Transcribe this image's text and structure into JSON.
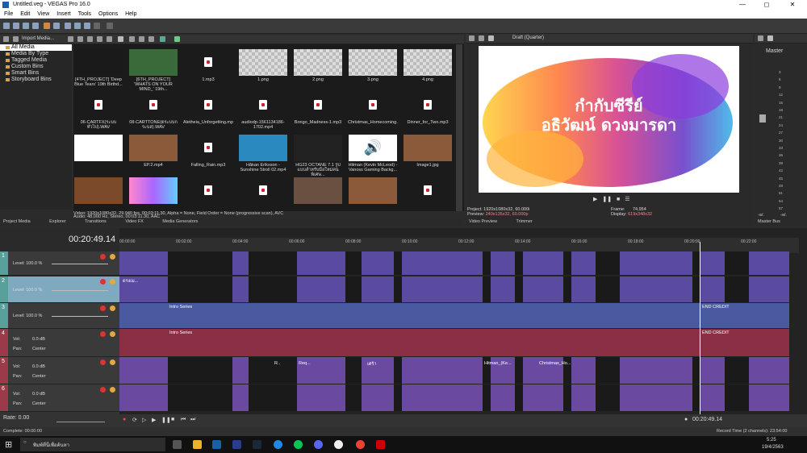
{
  "window": {
    "title": "Untitled.veg - VEGAS Pro 16.0"
  },
  "menu": [
    "File",
    "Edit",
    "View",
    "Insert",
    "Tools",
    "Options",
    "Help"
  ],
  "media_panel": {
    "import_label": "Import Media...",
    "tree": [
      {
        "label": "All Media",
        "selected": true
      },
      {
        "label": "Media By Type"
      },
      {
        "label": "Tagged Media"
      },
      {
        "label": "Custom Bins"
      },
      {
        "label": "Smart Bins"
      },
      {
        "label": "Storyboard Bins"
      }
    ],
    "items": [
      {
        "label": "[4TH_PROJECT] 'Deep Blue Tears' 19th Birthd...",
        "kind": "dark"
      },
      {
        "label": "[6TH_PROJECT] 'WHATS ON YOUR MIND_' 19th...",
        "kind": "green"
      },
      {
        "label": "1.mp3",
        "kind": "audio"
      },
      {
        "label": "1.png",
        "kind": "check"
      },
      {
        "label": "2.png",
        "kind": "check"
      },
      {
        "label": "3.png",
        "kind": "check"
      },
      {
        "label": "4.png",
        "kind": "check"
      },
      {
        "label": "06-CARTFX(ระบบทั่วไป).WAV",
        "kind": "audio"
      },
      {
        "label": "08-CARTTONE(ตระบบกระบส).WAV",
        "kind": "audio"
      },
      {
        "label": "Aletheia_Unforgetting.mp3",
        "kind": "audio"
      },
      {
        "label": "audiodp-1561134186-1702.mp4",
        "kind": "audio"
      },
      {
        "label": "Bongo_Madness-1.mp3",
        "kind": "audio"
      },
      {
        "label": "Christmas_Homecoming.mp3",
        "kind": "audio"
      },
      {
        "label": "Dinner_for_Two.mp3",
        "kind": "audio"
      },
      {
        "label": "",
        "kind": "title"
      },
      {
        "label": "EP.2.mp4",
        "kind": "room"
      },
      {
        "label": "Falling_Rain.mp3",
        "kind": "audio"
      },
      {
        "label": "Håkan Eriksson - Sunshine Stroll 02.mp4",
        "kind": "colorful"
      },
      {
        "label": "HG23 OCTANE 7.1 รูปแบบสำหรับมือใหม่คนพิเศษ...",
        "kind": "car"
      },
      {
        "label": "Hitman (Kevin McLeod) - Vanoss Gaming Backg...",
        "kind": "speaker"
      },
      {
        "label": "Image1.jpg",
        "kind": "room"
      },
      {
        "label": "",
        "kind": "room2"
      },
      {
        "label": "",
        "kind": "paint"
      },
      {
        "label": "",
        "kind": "audio"
      },
      {
        "label": "",
        "kind": "audio"
      },
      {
        "label": "",
        "kind": "room3"
      },
      {
        "label": "",
        "kind": "room"
      },
      {
        "label": "",
        "kind": "audio"
      }
    ],
    "status_line1": "Video: 1920x1080x32, 29.940 fps, 00:03:11.30, Alpha = None, Field Order = None (progressive scan), AVC",
    "status_line2": "Audio: 48,000 Hz, Stereo, 00:03:11.30, AAC",
    "tabs": [
      "Project Media",
      "Explorer",
      "Transitions",
      "Video FX",
      "Media Generators"
    ]
  },
  "preview": {
    "mode": "Draft (Quarter)",
    "title_line1": "กำกับซีรีย์",
    "title_line2": "อธิวัฒน์ ดวงมารดา",
    "project": "Project:  1920x1080x32, 60.000i",
    "preview_line": "Preview:",
    "preview_val": "240x135x32, 60.000p",
    "frame_label": "Frame:",
    "frame": "74,954",
    "display_label": "Display:",
    "display": "619x348x32",
    "tabs": [
      "Video Preview",
      "Trimmer"
    ]
  },
  "master": {
    "label": "Master",
    "tab": "Master Bus",
    "scale": [
      "3",
      "6",
      "9",
      "12",
      "15",
      "18",
      "21",
      "24",
      "27",
      "30",
      "33",
      "36",
      "39",
      "42",
      "45",
      "48",
      "51",
      "54",
      "57"
    ],
    "left": "-Inf.",
    "right": "-Inf."
  },
  "timeline": {
    "timecode": "00:20:49.14",
    "ruler": [
      "00:00:00",
      "00:02:00",
      "00:04:00",
      "00:06:00",
      "00:08:00",
      "00:10:00",
      "00:12:00",
      "00:14:00",
      "00:16:00",
      "00:18:00",
      "00:20:00",
      "00:22:00"
    ],
    "tracks": [
      {
        "num": "1",
        "level": "Level: 100.0 %",
        "type": "video"
      },
      {
        "num": "2",
        "level": "Level: 100.0 %",
        "type": "video",
        "selected": true
      },
      {
        "num": "3",
        "level": "Level: 100.0 %",
        "type": "video"
      },
      {
        "num": "4",
        "vol": "Vol:",
        "vol_val": "0.0 dB",
        "pan": "Pan:",
        "pan_val": "Center",
        "type": "audio"
      },
      {
        "num": "5",
        "vol": "Vol:",
        "vol_val": "0.0 dB",
        "pan": "Pan:",
        "pan_val": "Center",
        "type": "audio"
      },
      {
        "num": "6",
        "vol": "Vol:",
        "vol_val": "0.0 dB",
        "pan": "Pan:",
        "pan_val": "Center",
        "type": "audio"
      }
    ],
    "clip_labels": [
      "Intro Series",
      "END CREDIT",
      "Intro Series",
      "END CREDIT",
      "ดรงเม...",
      "R..",
      "Req...",
      "เศร้า",
      "Hitman_(Ke...",
      "Christmas_Ho..."
    ],
    "rate": "Rate: 0.00",
    "cursor_time": "00:20:49.14",
    "record_time": "Record Time (2 channels): 23:54:00"
  },
  "status": {
    "complete": "Complete: 00:00:00"
  },
  "taskbar": {
    "search": "พิมพ์ที่นี่เพื่อค้นหา",
    "time": "5:25",
    "date": "19/4/2563"
  },
  "colors": {
    "video_clip": "#4a5aa0",
    "audio_clip": "#8a2f44",
    "accent": "#3c78c8"
  }
}
